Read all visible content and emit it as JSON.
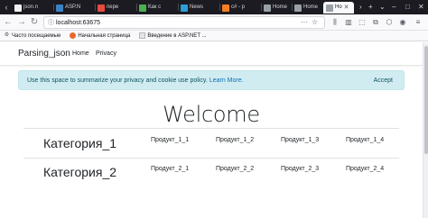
{
  "browser": {
    "tabs": [
      {
        "title": "json.n",
        "fav_color": "#f2f2f2"
      },
      {
        "title": "ASP.N",
        "fav_color": "#3b82c4"
      },
      {
        "title": "пере",
        "fav_color": "#e74c3c"
      },
      {
        "title": "Как с",
        "fav_color": "#4caf50"
      },
      {
        "title": "News",
        "fav_color": "#2a9fd6"
      },
      {
        "title": "c# - р",
        "fav_color": "#f48024"
      },
      {
        "title": "Home",
        "fav_color": "#9aa0a6"
      },
      {
        "title": "Home",
        "fav_color": "#9aa0a6"
      },
      {
        "title": "Ho",
        "fav_color": "#9aa0a6"
      }
    ],
    "new_tab": "+",
    "url": "localhost:63675",
    "bookmarks": [
      {
        "label": "Часто посещаемые",
        "icon": "gear-icon"
      },
      {
        "label": "Начальная страница",
        "icon": "firefox-icon"
      },
      {
        "label": "Введение в ASP.NET ...",
        "icon": "page-icon"
      }
    ]
  },
  "site": {
    "brand": "Parsing_json",
    "nav": [
      "Home",
      "Privacy"
    ],
    "cookie": {
      "message": "Use this space to summarize your privacy and cookie use policy.",
      "link": "Learn More.",
      "accept": "Accept"
    },
    "welcome": "Welcome",
    "categories": [
      {
        "name": "Категория_1",
        "products": [
          "Продукт_1_1",
          "Продукт_1_2",
          "Продукт_1_3",
          "Продукт_1_4"
        ]
      },
      {
        "name": "Категория_2",
        "products": [
          "Продукт_2_1",
          "Продукт_2_2",
          "Продукт_2_3",
          "Продукт_2_4"
        ]
      }
    ]
  }
}
